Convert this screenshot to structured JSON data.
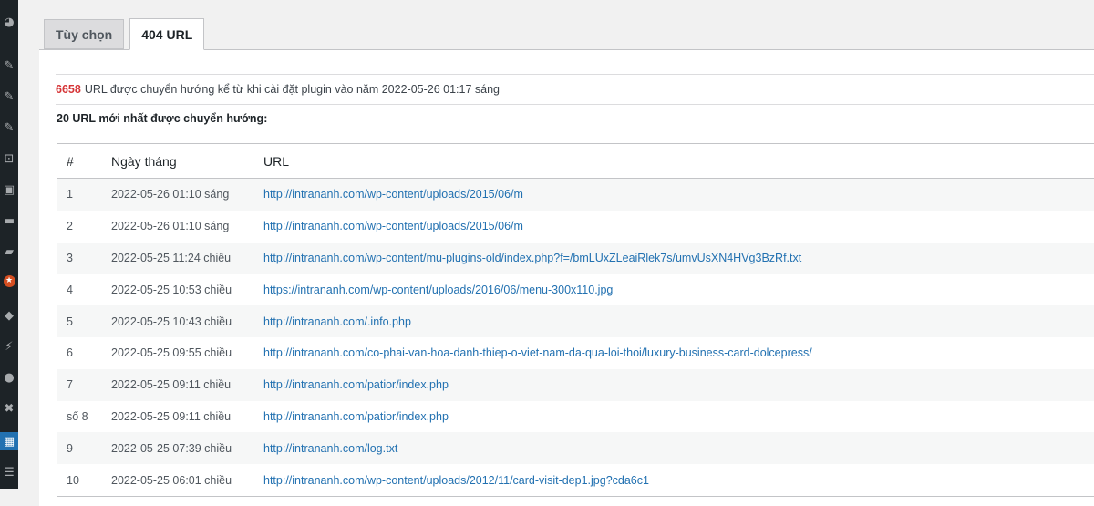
{
  "sidebar": {
    "icons": [
      {
        "name": "dashboard-icon",
        "glyph": "◕"
      },
      {
        "name": "pin-icon",
        "glyph": "✎"
      },
      {
        "name": "pin-icon-2",
        "glyph": "✎"
      },
      {
        "name": "pin-icon-3",
        "glyph": "✎"
      },
      {
        "name": "cart-icon",
        "glyph": "⊡"
      },
      {
        "name": "media-icon",
        "glyph": "▣"
      },
      {
        "name": "page-icon",
        "glyph": "▬"
      },
      {
        "name": "comment-icon",
        "glyph": "▰"
      },
      {
        "name": "star-badge-icon",
        "glyph": "★"
      },
      {
        "name": "brush-icon",
        "glyph": "◆"
      },
      {
        "name": "plugin-icon",
        "glyph": "⚡"
      },
      {
        "name": "users-icon",
        "glyph": "●"
      },
      {
        "name": "tools-icon",
        "glyph": "✖"
      },
      {
        "name": "settings-active-icon",
        "glyph": "▦"
      },
      {
        "name": "table-icon",
        "glyph": "☰"
      }
    ]
  },
  "tabs": [
    {
      "label": "Tùy chọn",
      "active": false
    },
    {
      "label": "404 URL",
      "active": true
    }
  ],
  "summary": {
    "count": "6658",
    "text": "URL được chuyển hướng kể từ khi cài đặt plugin vào năm 2022-05-26 01:17 sáng"
  },
  "latest_heading": "20 URL mới nhất được chuyển hướng:",
  "table": {
    "headers": {
      "num": "#",
      "date": "Ngày tháng",
      "url": "URL"
    },
    "rows": [
      {
        "num": "1",
        "date": "2022-05-26 01:10 sáng",
        "url": "http://intrananh.com/wp-content/uploads/2015/06/m"
      },
      {
        "num": "2",
        "date": "2022-05-26 01:10 sáng",
        "url": "http://intrananh.com/wp-content/uploads/2015/06/m"
      },
      {
        "num": "3",
        "date": "2022-05-25 11:24 chiều",
        "url": "http://intrananh.com/wp-content/mu-plugins-old/index.php?f=/bmLUxZLeaiRlek7s/umvUsXN4HVg3BzRf.txt"
      },
      {
        "num": "4",
        "date": "2022-05-25 10:53 chiều",
        "url": "https://intrananh.com/wp-content/uploads/2016/06/menu-300x110.jpg"
      },
      {
        "num": "5",
        "date": "2022-05-25 10:43 chiều",
        "url": "http://intrananh.com/.info.php"
      },
      {
        "num": "6",
        "date": "2022-05-25 09:55 chiều",
        "url": "http://intrananh.com/co-phai-van-hoa-danh-thiep-o-viet-nam-da-qua-loi-thoi/luxury-business-card-dolcepress/"
      },
      {
        "num": "7",
        "date": "2022-05-25 09:11 chiều",
        "url": "http://intrananh.com/patior/index.php"
      },
      {
        "num": "số 8",
        "date": "2022-05-25 09:11 chiều",
        "url": "http://intrananh.com/patior/index.php"
      },
      {
        "num": "9",
        "date": "2022-05-25 07:39 chiều",
        "url": "http://intrananh.com/log.txt"
      },
      {
        "num": "10",
        "date": "2022-05-25 06:01 chiều",
        "url": "http://intrananh.com/wp-content/uploads/2012/11/card-visit-dep1.jpg?cda6c1"
      }
    ]
  }
}
